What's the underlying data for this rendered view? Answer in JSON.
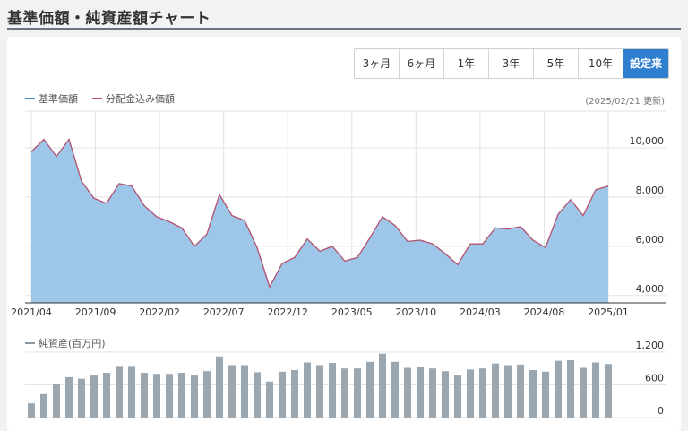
{
  "page": {
    "title": "基準価額・純資産額チャート"
  },
  "period_tabs": [
    {
      "label": "3ヶ月",
      "active": false
    },
    {
      "label": "6ヶ月",
      "active": false
    },
    {
      "label": "1年",
      "active": false
    },
    {
      "label": "3年",
      "active": false
    },
    {
      "label": "5年",
      "active": false
    },
    {
      "label": "10年",
      "active": false
    },
    {
      "label": "設定来",
      "active": true
    }
  ],
  "legend": {
    "nav_label": "基準価額",
    "nav_color": "#4a90c8",
    "adjusted_label": "分配金込み価額",
    "adjusted_color": "#c0506a",
    "updated_note": "(2025/02/21 更新)"
  },
  "sub_legend": {
    "label": "純資産(百万円)",
    "color": "#8a96a0"
  },
  "colors": {
    "area_fill": "#9dc6e9",
    "bar_fill": "#9aa6b0",
    "active_tab": "#2f7fd0"
  },
  "chart_data": [
    {
      "type": "area",
      "title": "",
      "x_tick_labels": [
        "2021/04",
        "2021/09",
        "2022/02",
        "2022/07",
        "2022/12",
        "2023/05",
        "2023/10",
        "2024/03",
        "2024/08",
        "2025/01"
      ],
      "y_ticks": [
        4000,
        6000,
        8000,
        10000
      ],
      "y_tick_labels": [
        "4,000",
        "6,000",
        "8,000",
        "10,000"
      ],
      "ylim": [
        3700,
        11500
      ],
      "grid": true,
      "series": [
        {
          "name": "基準価額",
          "values": [
            9850,
            10350,
            9650,
            10350,
            8650,
            7950,
            7750,
            8550,
            8450,
            7650,
            7200,
            7000,
            6750,
            6000,
            6500,
            8100,
            7250,
            7050,
            5950,
            4350,
            5300,
            5550,
            6300,
            5800,
            6000,
            5400,
            5550,
            6350,
            7200,
            6850,
            6200,
            6250,
            6100,
            5700,
            5250,
            6100,
            6100,
            6750,
            6700,
            6800,
            6250,
            5950,
            7300,
            7900,
            7250,
            8300,
            8450
          ]
        },
        {
          "name": "分配金込み価額",
          "values": [
            9850,
            10350,
            9650,
            10350,
            8650,
            7950,
            7750,
            8550,
            8450,
            7650,
            7200,
            7000,
            6750,
            6000,
            6500,
            8100,
            7250,
            7050,
            5950,
            4350,
            5300,
            5550,
            6300,
            5800,
            6000,
            5400,
            5550,
            6350,
            7200,
            6850,
            6200,
            6250,
            6100,
            5700,
            5250,
            6100,
            6100,
            6750,
            6700,
            6800,
            6250,
            5950,
            7300,
            7900,
            7250,
            8300,
            8450
          ]
        }
      ]
    },
    {
      "type": "bar",
      "title": "",
      "y_ticks": [
        0,
        600,
        1200
      ],
      "y_tick_labels": [
        "0",
        "600",
        "1,200"
      ],
      "ylim": [
        0,
        1280
      ],
      "series": [
        {
          "name": "純資産(百万円)",
          "values": [
            260,
            430,
            610,
            740,
            710,
            770,
            820,
            930,
            930,
            820,
            800,
            800,
            820,
            770,
            850,
            1120,
            960,
            960,
            830,
            660,
            840,
            870,
            1010,
            960,
            1000,
            900,
            900,
            1020,
            1170,
            1020,
            910,
            920,
            900,
            850,
            770,
            880,
            900,
            990,
            960,
            970,
            870,
            840,
            1040,
            1050,
            910,
            1010,
            980
          ]
        }
      ]
    }
  ]
}
